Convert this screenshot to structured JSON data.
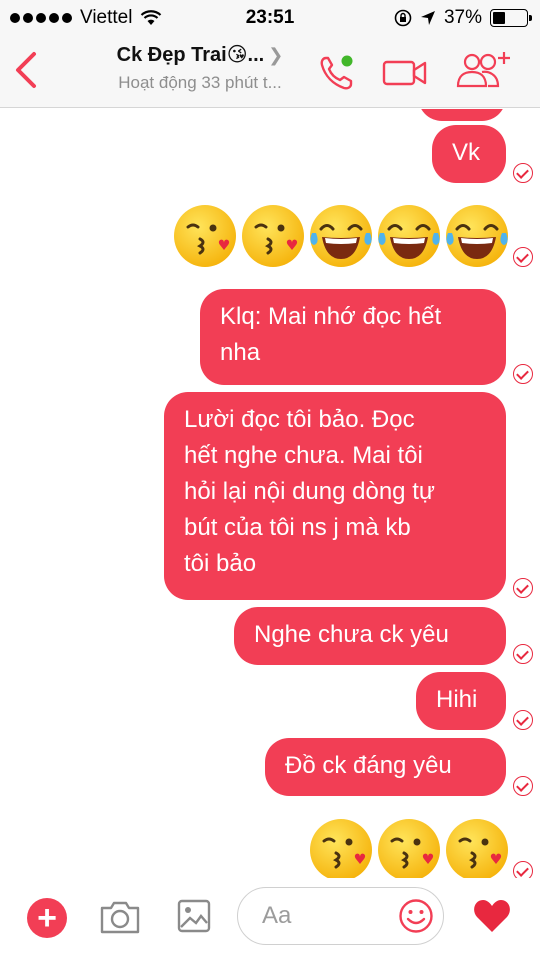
{
  "status_bar": {
    "carrier": "Viettel",
    "time": "23:51",
    "battery": "37%",
    "battery_level": 0.37
  },
  "header": {
    "title": "Ck Đẹp Trai😘...",
    "subtitle": "Hoạt động 33 phút t..."
  },
  "messages": [
    {
      "type": "text",
      "text": "Vk"
    },
    {
      "type": "emoji",
      "icons": [
        "kiss-emoji",
        "kiss-emoji",
        "tears-of-joy-emoji",
        "tears-of-joy-emoji",
        "tears-of-joy-emoji"
      ]
    },
    {
      "type": "text",
      "lines": [
        "Klq: Mai nhớ đọc hết",
        "nha"
      ]
    },
    {
      "type": "text",
      "lines": [
        "Lười đọc tôi bảo. Đọc",
        "hết nghe chưa. Mai tôi",
        "hỏi lại nội dung dòng tự",
        "bút của tôi ns j mà kb",
        "tôi bảo"
      ]
    },
    {
      "type": "text",
      "text": "Nghe chưa ck yêu"
    },
    {
      "type": "text",
      "text": "Hihi"
    },
    {
      "type": "text",
      "text": "Đồ ck đáng yêu"
    },
    {
      "type": "emoji",
      "icons": [
        "kiss-emoji",
        "kiss-emoji",
        "kiss-emoji"
      ]
    }
  ],
  "composer": {
    "placeholder": "Aa"
  },
  "colors": {
    "accent": "#f23e55",
    "header_bg": "#f7f7f7"
  }
}
